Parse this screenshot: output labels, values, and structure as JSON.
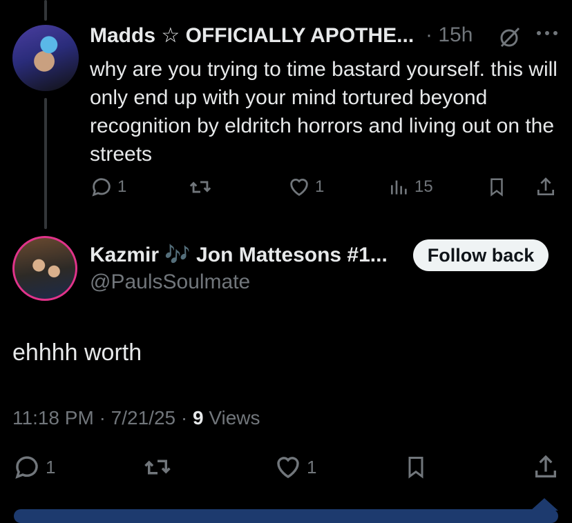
{
  "reply": {
    "display_name": "Madds ☆ OFFICIALLY APOTHE...",
    "separator": "·",
    "time": "15h",
    "text": "why are you trying to time bastard yourself. this will only end up with your mind tortured beyond recognition by eldritch horrors and living out on the streets",
    "reply_count": "1",
    "like_count": "1",
    "view_count": "15"
  },
  "main": {
    "display_name": "Kazmir 🎶 Jon Mattesons #1...",
    "handle": "@PaulsSoulmate",
    "follow_label": "Follow back",
    "text": "ehhhh worth",
    "time": "11:18 PM",
    "date": "7/21/25",
    "views_count": "9",
    "views_label": "Views",
    "reply_count": "1",
    "like_count": "1"
  },
  "colors": {
    "background": "#000000",
    "text": "#e7e9ea",
    "muted": "#71767b",
    "button_bg": "#eff3f4"
  }
}
